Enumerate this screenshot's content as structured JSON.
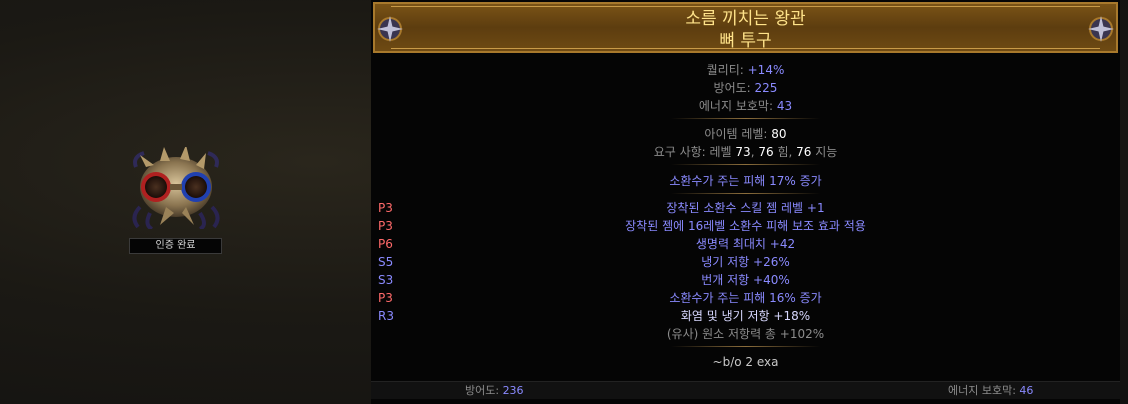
{
  "item_card": {
    "badge": "인증 완료",
    "icon": "bone-helmet-icon"
  },
  "tooltip": {
    "name": "소름 끼치는 왕관",
    "base": "뼈 투구",
    "properties": [
      {
        "label": "퀄리티: ",
        "value": "+14%"
      },
      {
        "label": "방어도: ",
        "value": "225"
      },
      {
        "label": "에너지 보호막: ",
        "value": "43"
      }
    ],
    "item_level": {
      "label": "아이템 레벨: ",
      "value": "80"
    },
    "requirements": {
      "prefix": "요구 사항: 레벨 ",
      "level": "73",
      "sep1": ", ",
      "str": "76",
      "str_label": " 힘, ",
      "int": "76",
      "int_label": " 지능"
    },
    "implicit": "소환수가 주는 피해 17% 증가",
    "mods": [
      {
        "tag": "P3",
        "text": "장착된 소환수 스킬 젬 레벨 +1"
      },
      {
        "tag": "P3",
        "text": "장착된 젬에 16레벨 소환수 피해 보조 효과 적용"
      },
      {
        "tag": "P6",
        "text": "생명력 최대치 +42"
      },
      {
        "tag": "S5",
        "text": "냉기 저항 +26%"
      },
      {
        "tag": "S3",
        "text": "번개 저항 +40%"
      },
      {
        "tag": "P3",
        "text": "소환수가 주는 피해 16% 증가"
      },
      {
        "tag": "R3",
        "text": "화염 및 냉기 저항 +18%"
      }
    ],
    "pseudo": "(유사) 원소 저항력 총 +102%",
    "price": "~b/o 2 exa"
  },
  "footer": {
    "armour_label": "방어도: ",
    "armour_value": "236",
    "es_label": "에너지 보호막: ",
    "es_value": "46"
  },
  "colors": {
    "header_bg": "#6e4a13",
    "title": "#ffe38a",
    "magic_blue": "#8a8aff",
    "prefix_red": "#ff6a6a"
  }
}
